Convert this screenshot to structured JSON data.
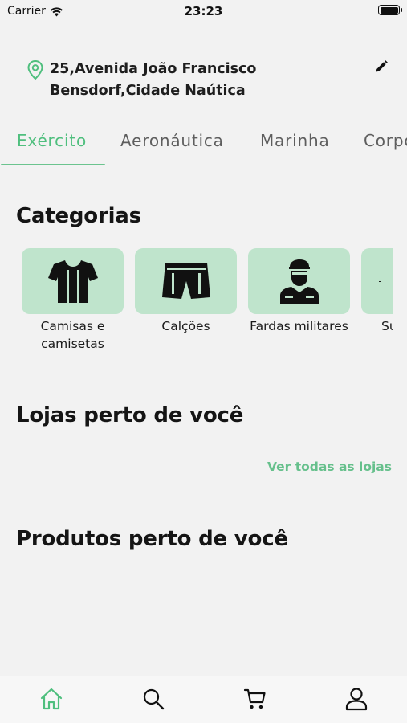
{
  "status_bar": {
    "carrier": "Carrier",
    "time": "23:23"
  },
  "address": {
    "text": "25,Avenida João Francisco Bensdorf,Cidade Naútica",
    "icon": "map-pin-icon",
    "edit_icon": "pencil-icon"
  },
  "tabs": [
    {
      "label": "Exército",
      "active": true
    },
    {
      "label": "Aeronáutica",
      "active": false
    },
    {
      "label": "Marinha",
      "active": false
    },
    {
      "label": "Corpo",
      "active": false
    }
  ],
  "categories": {
    "title": "Categorias",
    "items": [
      {
        "label": "Camisas e camisetas",
        "icon": "tshirt-icon"
      },
      {
        "label": "Calções",
        "icon": "shorts-icon"
      },
      {
        "label": "Fardas militares",
        "icon": "soldier-icon"
      },
      {
        "label": "Su…",
        "icon": "category-icon"
      }
    ]
  },
  "stores": {
    "title": "Lojas perto de você",
    "see_all": "Ver todas as lojas"
  },
  "products": {
    "title": "Produtos perto de você"
  },
  "bottom_nav": [
    {
      "name": "home",
      "icon": "home-icon",
      "active": true
    },
    {
      "name": "search",
      "icon": "search-icon",
      "active": false
    },
    {
      "name": "cart",
      "icon": "cart-icon",
      "active": false
    },
    {
      "name": "profile",
      "icon": "user-icon",
      "active": false
    }
  ],
  "colors": {
    "accent": "#4fbf7e",
    "category_card": "#bfe4cc",
    "background": "#f2f2f2"
  }
}
